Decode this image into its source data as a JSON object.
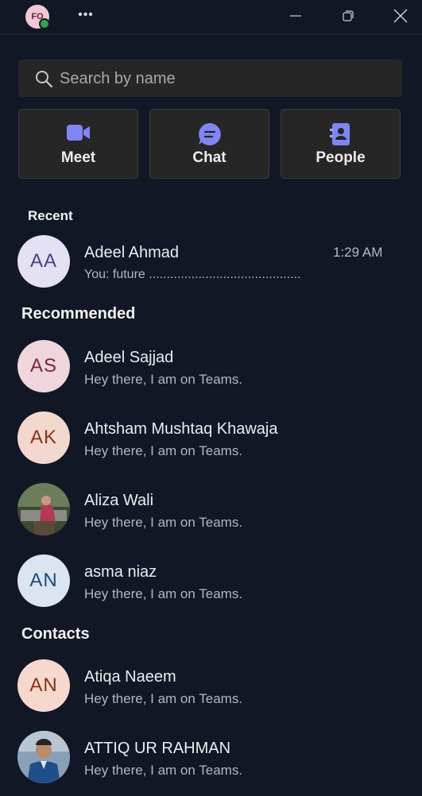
{
  "titlebar": {
    "avatar_initials": "FO",
    "more_label": "•••",
    "presence": "available"
  },
  "search": {
    "placeholder": "Search by name"
  },
  "quick_actions": [
    {
      "label": "Meet",
      "icon": "video-camera-icon",
      "color": "#7f85f5"
    },
    {
      "label": "Chat",
      "icon": "chat-bubble-icon",
      "color": "#7f85f5"
    },
    {
      "label": "People",
      "icon": "contact-book-icon",
      "color": "#7f85f5"
    }
  ],
  "recent": {
    "heading": "Recent",
    "items": [
      {
        "initials": "AA",
        "name": "Adeel Ahmad",
        "preview": "You: future ...........................................",
        "time": "1:29 AM",
        "avatar_bg": "#e3e1f2",
        "avatar_fg": "#4b3f8a"
      }
    ]
  },
  "recommended": {
    "heading": "Recommended",
    "items": [
      {
        "initials": "AS",
        "name": "Adeel Sajjad",
        "status": "Hey there, I am on Teams.",
        "avatar_bg": "#eed6dc",
        "avatar_fg": "#7a2638"
      },
      {
        "initials": "AK",
        "name": "Ahtsham Mushtaq Khawaja",
        "status": "Hey there, I am on Teams.",
        "avatar_bg": "#f3d8cf",
        "avatar_fg": "#8a3217"
      },
      {
        "initials": "",
        "name": "Aliza Wali",
        "status": "Hey there, I am on Teams.",
        "avatar_bg": "#4a5a3c",
        "avatar_fg": "#ffffff"
      },
      {
        "initials": "AN",
        "name": "asma niaz",
        "status": "Hey there, I am on Teams.",
        "avatar_bg": "#dbe5f1",
        "avatar_fg": "#1f4a78"
      }
    ]
  },
  "contacts": {
    "heading": "Contacts",
    "items": [
      {
        "initials": "AN",
        "name": "Atiqa Naeem",
        "status": "Hey there, I am on Teams.",
        "avatar_bg": "#f6d8cf",
        "avatar_fg": "#8a3217"
      },
      {
        "initials": "",
        "name": "ATTIQ UR RAHMAN",
        "status": "Hey there, I am on Teams.",
        "avatar_bg": "#6f86a0",
        "avatar_fg": "#ffffff"
      }
    ]
  }
}
